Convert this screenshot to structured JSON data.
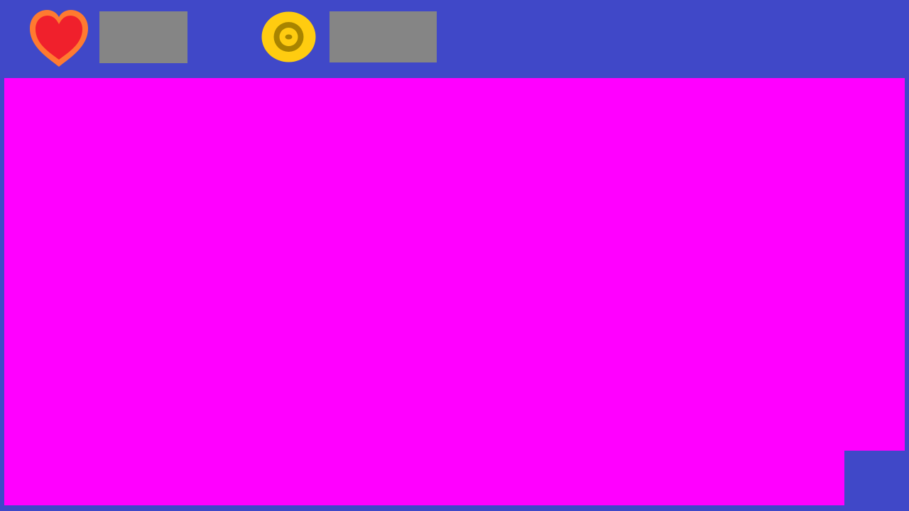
{
  "theme": {
    "background": "#4048C8",
    "viewport": "#FF00FF",
    "placeholder": "#858585"
  },
  "hud": {
    "health": {
      "icon": "heart-icon",
      "fill_color": "#F0202C",
      "outline_color": "#FF7A30",
      "value": ""
    },
    "coins": {
      "icon": "coin-icon",
      "fill_color": "#FFCC10",
      "ring_color": "#A88400",
      "value": ""
    }
  }
}
